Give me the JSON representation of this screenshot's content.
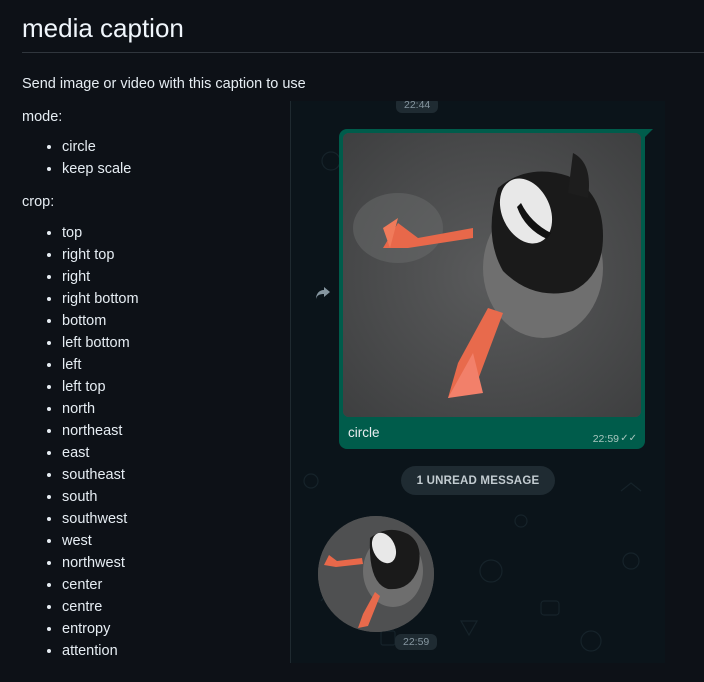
{
  "doc": {
    "title": "media caption",
    "intro": "Send image or video with this caption to use"
  },
  "mode": {
    "label": "mode:",
    "items": [
      "circle",
      "keep scale"
    ]
  },
  "crop": {
    "label": "crop:",
    "items": [
      "top",
      "right top",
      "right",
      "right bottom",
      "bottom",
      "left bottom",
      "left",
      "left top",
      "north",
      "northeast",
      "east",
      "southeast",
      "south",
      "southwest",
      "west",
      "northwest",
      "center",
      "centre",
      "entropy",
      "attention"
    ]
  },
  "chat": {
    "top_time": "22:44",
    "message": {
      "caption": "circle",
      "time": "22:59",
      "status_icon": "double-check-icon"
    },
    "unread_label": "1 UNREAD MESSAGE",
    "video_note_time": "22:59",
    "forward_icon": "forward-arrow-icon"
  },
  "colors": {
    "page_bg": "#0d1117",
    "chat_bg": "#0b141a",
    "outgoing_bubble": "#005c4b",
    "pill_bg": "#1f2b32"
  }
}
